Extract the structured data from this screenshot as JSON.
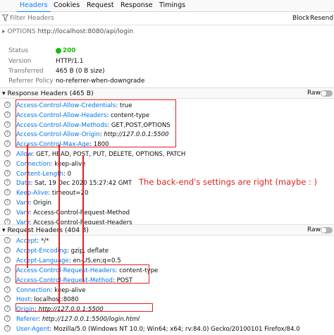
{
  "tabs": [
    {
      "label": "Headers",
      "selected": true
    },
    {
      "label": "Cookies",
      "selected": false
    },
    {
      "label": "Request",
      "selected": false
    },
    {
      "label": "Response",
      "selected": false
    },
    {
      "label": "Timings",
      "selected": false
    }
  ],
  "filter": {
    "placeholder": "Filter Headers",
    "block_label": "Block",
    "resend_label": "Resend"
  },
  "request_line": {
    "method": "OPTIONS",
    "url": "http://localhost:8080/api/login"
  },
  "summary": [
    {
      "key": "Status",
      "value": "200"
    },
    {
      "key": "Version",
      "value": "HTTP/1.1"
    },
    {
      "key": "Transferred",
      "value": "465 B (0 B size)"
    },
    {
      "key": "Referrer Policy",
      "value": "no-referrer-when-downgrade"
    }
  ],
  "response_section": {
    "title": "Response Headers (465 B)",
    "raw_label": "Raw"
  },
  "response_headers": [
    {
      "name": "Access-Control-Allow-Credentials",
      "value": "true"
    },
    {
      "name": "Access-Control-Allow-Headers",
      "value": "content-type"
    },
    {
      "name": "Access-Control-Allow-Methods",
      "value": "GET,POST,OPTIONS"
    },
    {
      "name": "Access-Control-Allow-Origin",
      "value": "http://127.0.0.1:5500"
    },
    {
      "name": "Access-Control-Max-Age",
      "value": "1800"
    },
    {
      "name": "Allow",
      "value": "GET, HEAD, POST, PUT, DELETE, OPTIONS, PATCH"
    },
    {
      "name": "Connection",
      "value": "keep-alive"
    },
    {
      "name": "Content-Length",
      "value": "0"
    },
    {
      "name": "Date",
      "value": "Sat, 19 Dec 2020 15:27:42 GMT"
    },
    {
      "name": "Keep-Alive",
      "value": "timeout=20"
    },
    {
      "name": "Vary",
      "value": "Origin"
    },
    {
      "name": "Vary",
      "value": "Access-Control-Request-Method"
    },
    {
      "name": "Vary",
      "value": "Access-Control-Request-Headers"
    }
  ],
  "request_section": {
    "title": "Request Headers (404 B)",
    "raw_label": "Raw"
  },
  "request_headers": [
    {
      "name": "Accept",
      "value": "*/*"
    },
    {
      "name": "Accept-Encoding",
      "value": "gzip, deflate"
    },
    {
      "name": "Accept-Language",
      "value": "en-US,en;q=0.5"
    },
    {
      "name": "Access-Control-Request-Headers",
      "value": "content-type"
    },
    {
      "name": "Access-Control-Request-Method",
      "value": "POST"
    },
    {
      "name": "Connection",
      "value": "keep-alive"
    },
    {
      "name": "Host",
      "value": "localhost:8080"
    },
    {
      "name": "Origin",
      "value": "http://127.0.0.1:5500"
    },
    {
      "name": "Referer",
      "value": "http://127.0.0.1:5500/login.html"
    },
    {
      "name": "User-Agent",
      "value": "Mozilla/5.0 (Windows NT 10.0; Win64; x64; rv:84.0) Gecko/20100101 Firefox/84.0"
    }
  ],
  "annotation": "The back-end's settings are right (maybe : )",
  "colors": {
    "accent": "#0a84ff",
    "header_name": "#0074e8",
    "status_ok": "#12bc00",
    "annotation": "#e02020"
  },
  "icons": [
    "filter-icon",
    "question-icon",
    "chevron-down-icon"
  ]
}
